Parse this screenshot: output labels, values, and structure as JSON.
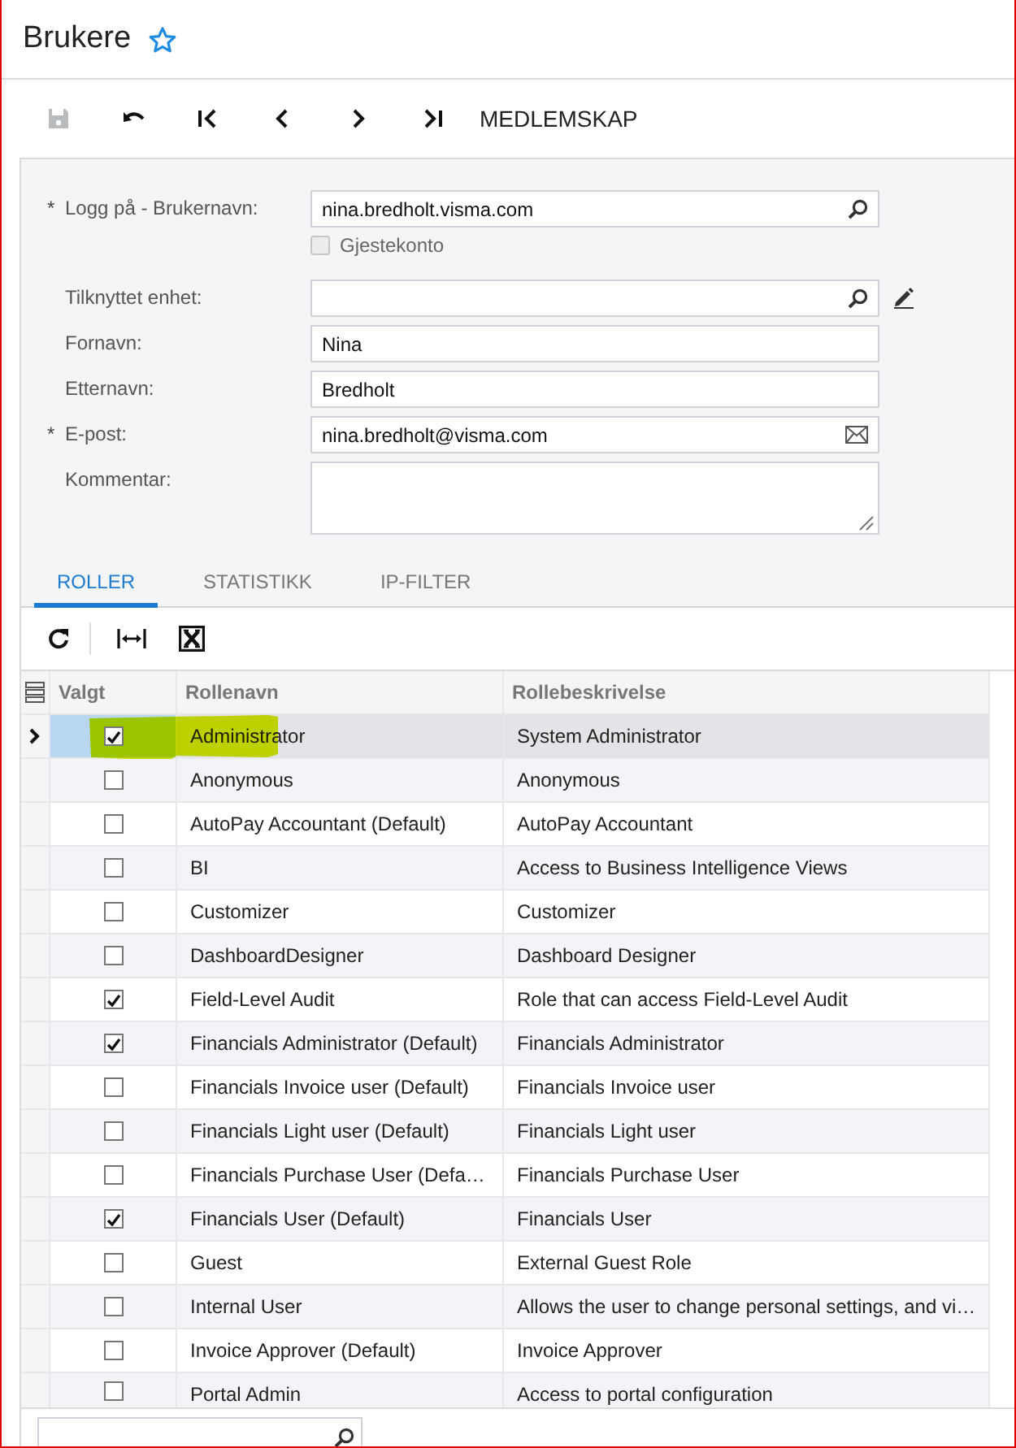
{
  "page": {
    "title": "Brukere",
    "favorite": false
  },
  "toolbar": {
    "buttons": [
      {
        "kind": "save",
        "disabled": true
      },
      {
        "kind": "undo",
        "disabled": false
      },
      {
        "kind": "first",
        "disabled": false
      },
      {
        "kind": "previous",
        "disabled": false
      },
      {
        "kind": "next",
        "disabled": false
      },
      {
        "kind": "last",
        "disabled": false
      }
    ],
    "action": "MEDLEMSKAP"
  },
  "form": {
    "fields": [
      {
        "kind": "lookup",
        "label": "Logg på - Brukernavn:",
        "required_mark": "*",
        "value": "nina.bredholt.visma.com"
      },
      {
        "kind": "checkbox",
        "label": "Gjestekonto",
        "checked": false,
        "disabled": true
      },
      {
        "kind": "lookup-edit",
        "label": "Tilknyttet enhet:"
      },
      {
        "kind": "text",
        "label": "Fornavn:",
        "value": "Nina"
      },
      {
        "kind": "text",
        "label": "Etternavn:",
        "value": "Bredholt"
      },
      {
        "kind": "email",
        "label": "E-post:",
        "required_mark": "*",
        "value": "nina.bredholt@visma.com"
      },
      {
        "kind": "textarea",
        "label": "Kommentar:"
      }
    ]
  },
  "tabs": [
    {
      "label": "ROLLER",
      "selected": true
    },
    {
      "label": "STATISTIKK",
      "selected": false
    },
    {
      "label": "IP-FILTER",
      "selected": false
    }
  ],
  "table": {
    "columns": [
      "Valgt",
      "Rollenavn",
      "Rollebeskrivelse"
    ],
    "rows": [
      {
        "selected": true,
        "highlighted": true,
        "checked": true,
        "name": "Administrator",
        "description": "System Administrator"
      },
      {
        "selected": false,
        "highlighted": false,
        "checked": false,
        "name": "Anonymous",
        "description": "Anonymous"
      },
      {
        "selected": false,
        "highlighted": false,
        "checked": false,
        "name": "AutoPay Accountant (Default)",
        "description": "AutoPay Accountant"
      },
      {
        "selected": false,
        "highlighted": false,
        "checked": false,
        "name": "BI",
        "description": "Access to Business Intelligence Views"
      },
      {
        "selected": false,
        "highlighted": false,
        "checked": false,
        "name": "Customizer",
        "description": "Customizer"
      },
      {
        "selected": false,
        "highlighted": false,
        "checked": false,
        "name": "DashboardDesigner",
        "description": "Dashboard Designer"
      },
      {
        "selected": false,
        "highlighted": false,
        "checked": true,
        "name": "Field-Level Audit",
        "description": "Role that can access Field-Level Audit"
      },
      {
        "selected": false,
        "highlighted": false,
        "checked": true,
        "name": "Financials Administrator (Default)",
        "description": "Financials Administrator"
      },
      {
        "selected": false,
        "highlighted": false,
        "checked": false,
        "name": "Financials Invoice user (Default)",
        "description": "Financials Invoice user"
      },
      {
        "selected": false,
        "highlighted": false,
        "checked": false,
        "name": "Financials Light user (Default)",
        "description": "Financials Light user"
      },
      {
        "selected": false,
        "highlighted": false,
        "checked": false,
        "name": "Financials Purchase User (Defa…",
        "description": "Financials Purchase User"
      },
      {
        "selected": false,
        "highlighted": false,
        "checked": true,
        "name": "Financials User (Default)",
        "description": "Financials User"
      },
      {
        "selected": false,
        "highlighted": false,
        "checked": false,
        "name": "Guest",
        "description": "External Guest Role"
      },
      {
        "selected": false,
        "highlighted": false,
        "checked": false,
        "name": "Internal User",
        "description": "Allows the user to change personal settings, and vi…"
      },
      {
        "selected": false,
        "highlighted": false,
        "checked": false,
        "name": "Invoice Approver (Default)",
        "description": "Invoice Approver"
      },
      {
        "selected": false,
        "highlighted": false,
        "checked": false,
        "name": "Portal Admin",
        "description": "Access to portal configuration"
      }
    ]
  }
}
